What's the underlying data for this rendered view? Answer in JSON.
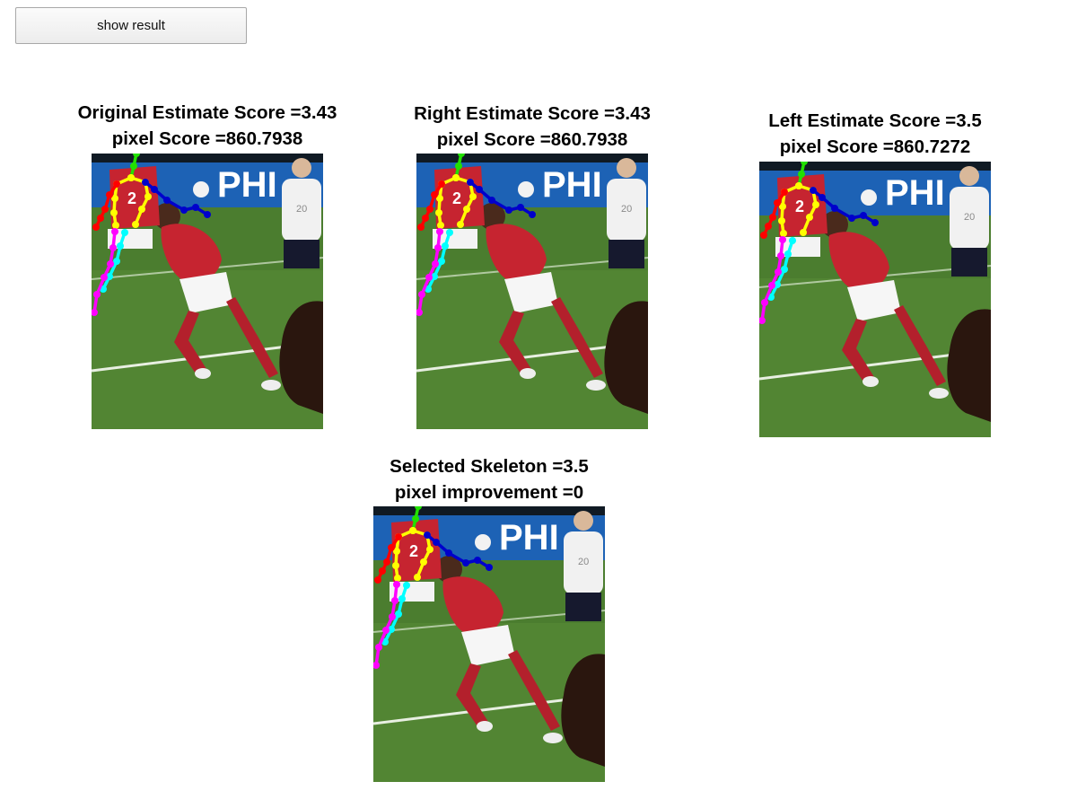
{
  "toolbar": {
    "show_result_label": "show result"
  },
  "panels": [
    {
      "title": "Original Estimate Score =3.43",
      "subtitle": "pixel Score =860.7938"
    },
    {
      "title": "Right Estimate Score =3.43",
      "subtitle": "pixel Score =860.7938"
    },
    {
      "title": "Left Estimate Score =3.5",
      "subtitle": "pixel Score =860.7272"
    },
    {
      "title": "Selected Skeleton =3.5",
      "subtitle": "pixel improvement =0"
    }
  ],
  "photo": {
    "banner_text": "PHI",
    "jersey_number_front": "2",
    "jersey_number_back": "20"
  },
  "colors": {
    "head": "#22e000",
    "torso": "#ffff00",
    "right_arm": "#0000cc",
    "left_arm": "#ff0000",
    "right_leg": "#00ffff",
    "left_leg": "#ff00ff",
    "grass": "#4b7d2f",
    "banner": "#1d62b5",
    "jersey": "#c62430"
  }
}
